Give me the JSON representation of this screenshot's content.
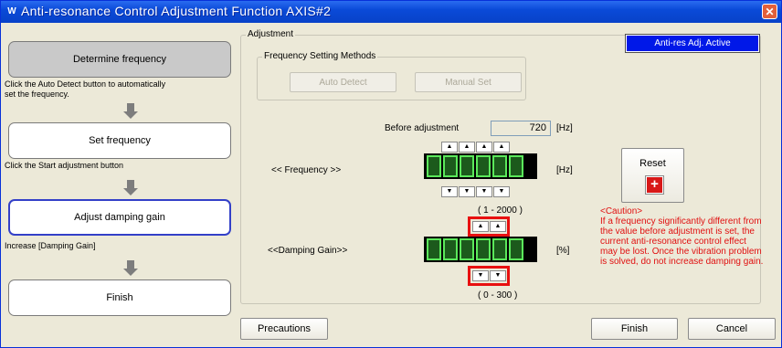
{
  "window": {
    "title": "Anti-resonance Control Adjustment Function AXIS#2",
    "app_icon": "W",
    "close_glyph": "✕"
  },
  "steps": [
    {
      "label": "Determine frequency",
      "state": "done"
    },
    {
      "label": "Set frequency",
      "state": "pending"
    },
    {
      "label": "Adjust damping gain",
      "state": "active"
    },
    {
      "label": "Finish",
      "state": "pending"
    }
  ],
  "hints": {
    "determine": "Click the Auto Detect button to automatically set the frequency.",
    "set": "Click the Start adjustment button",
    "adjust": "Increase [Damping Gain]"
  },
  "adjustment": {
    "group_label": "Adjustment",
    "status_badge": "Anti-res Adj. Active",
    "freq_methods": {
      "label": "Frequency Setting Methods",
      "auto_detect": "Auto Detect",
      "manual_set": "Manual Set"
    },
    "before_adjustment_label": "Before adjustment",
    "before_adjustment_value": "720",
    "hz_unit": "[Hz]",
    "frequency": {
      "label": "<< Frequency >>",
      "unit": "[Hz]",
      "range": "( 1 - 2000 )"
    },
    "damping": {
      "label": "<<Damping Gain>>",
      "unit": "[%]",
      "range": "( 0 - 300 )"
    },
    "up_glyph": "▲",
    "down_glyph": "▼"
  },
  "reset": {
    "label": "Reset",
    "icon_glyph": "+"
  },
  "caution": {
    "title": "<Caution>",
    "body": "If a frequency significantly different from the value before adjustment is set, the current anti-resonance control effect may be lost. Once the vibration problem is solved, do not increase damping gain."
  },
  "footer": {
    "precautions": "Precautions",
    "finish": "Finish",
    "cancel": "Cancel"
  },
  "colors": {
    "title_bar": "#0a4ad8",
    "active_badge": "#0018e8",
    "caution_text": "#e01010",
    "highlight_box": "#e81010",
    "lcd_segment": "#5be85b"
  }
}
